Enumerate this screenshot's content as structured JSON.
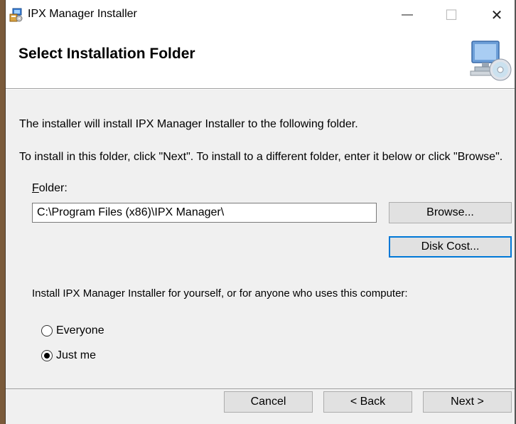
{
  "window": {
    "title": "IPX Manager Installer",
    "icon": "installer-app-icon",
    "minimize_glyph": "—",
    "maximize_glyph": "☐",
    "close_glyph": "✕"
  },
  "header": {
    "title": "Select Installation Folder",
    "graphic": "computer-with-cd-icon"
  },
  "body": {
    "install_text": "The installer will install IPX Manager Installer to the following folder.",
    "instructions": "To install in this folder, click \"Next\". To install to a different folder, enter it below or click \"Browse\".",
    "folder_label_accel": "F",
    "folder_label_rest": "older:",
    "folder_value": "C:\\Program Files (x86)\\IPX Manager\\",
    "browse_label": "Browse...",
    "disk_cost_label": "Disk Cost...",
    "who_text": "Install IPX Manager Installer for yourself, or for anyone who uses this computer:",
    "radios": [
      {
        "label": "Everyone",
        "selected": false
      },
      {
        "label": "Just me",
        "selected": true
      }
    ]
  },
  "footer": {
    "cancel_label": "Cancel",
    "back_label": "< Back",
    "next_label": "Next >"
  },
  "colors": {
    "focus_border": "#0078d7",
    "button_bg": "#e1e1e1",
    "dialog_bg": "#f0f0f0"
  }
}
